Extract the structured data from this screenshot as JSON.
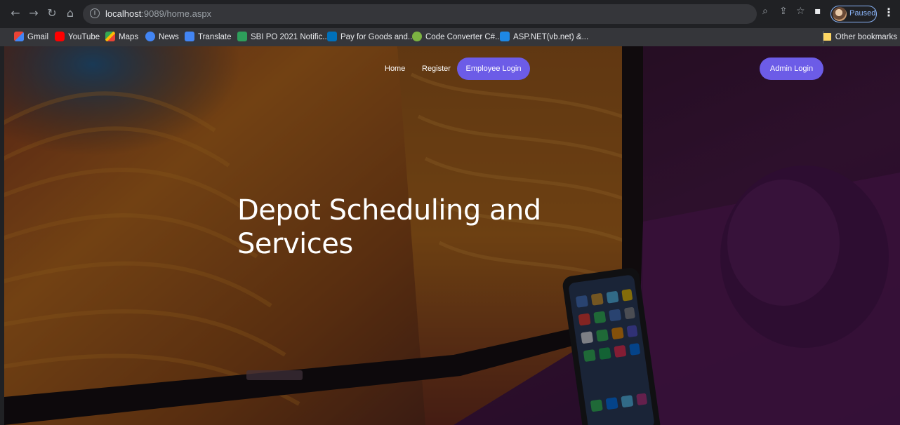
{
  "browser": {
    "url_host": "localhost",
    "url_rest": ":9089/home.aspx",
    "profile_status": "Paused",
    "bookmarks": [
      {
        "label": "Gmail",
        "icon": "gmail-icon",
        "color": "#ea4335"
      },
      {
        "label": "YouTube",
        "icon": "youtube-icon",
        "color": "#ff0000"
      },
      {
        "label": "Maps",
        "icon": "maps-icon",
        "color": "#34a853"
      },
      {
        "label": "News",
        "icon": "news-icon",
        "color": "#4285f4"
      },
      {
        "label": "Translate",
        "icon": "translate-icon",
        "color": "#4285f4"
      },
      {
        "label": "SBI PO 2021 Notific...",
        "icon": "sbi-icon",
        "color": "#2e9e5b"
      },
      {
        "label": "Pay for Goods and...",
        "icon": "paypal-icon",
        "color": "#0070ba"
      },
      {
        "label": "Code Converter C#...",
        "icon": "code-converter-icon",
        "color": "#7cb342"
      },
      {
        "label": "ASP.NET(vb.net) &...",
        "icon": "s-logo-icon",
        "color": "#1e88e5"
      }
    ],
    "other_bookmarks": "Other bookmarks"
  },
  "page": {
    "nav": {
      "home": "Home",
      "register": "Register",
      "employee_login": "Employee Login",
      "admin_login": "Admin Login"
    },
    "hero_title": "Depot Scheduling and Services",
    "accent_color": "#6c5ce7"
  }
}
